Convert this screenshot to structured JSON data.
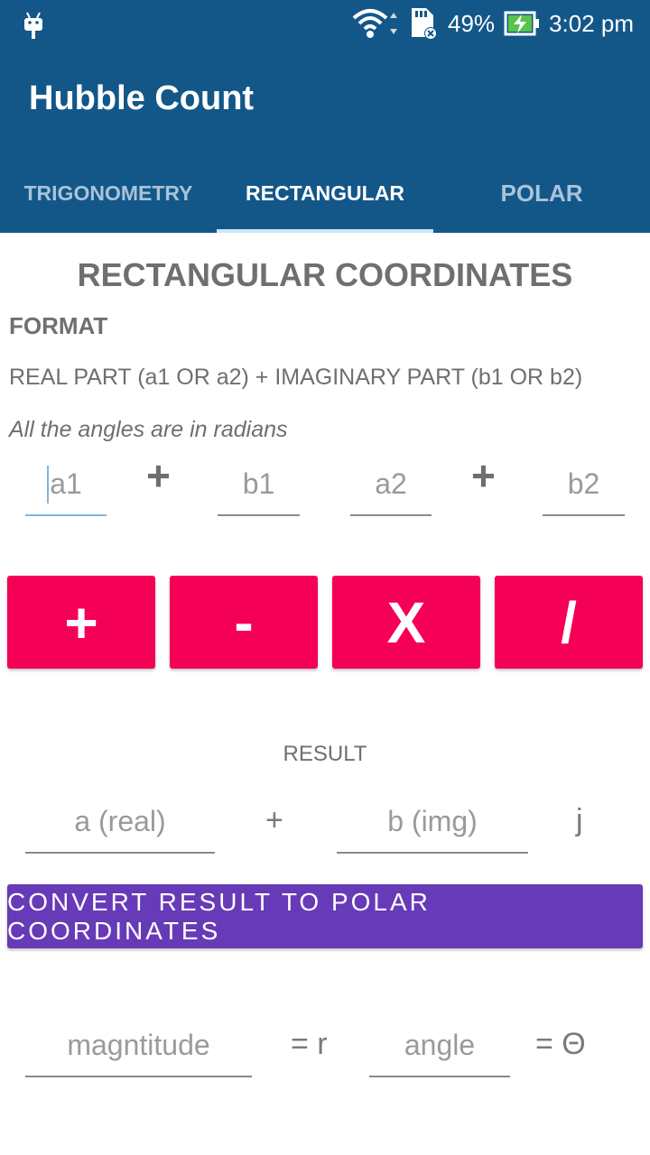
{
  "status_bar": {
    "battery": "49%",
    "time": "3:02 pm",
    "icons": [
      "android-icon",
      "wifi-icon",
      "sd-card-icon",
      "battery-charging-icon"
    ]
  },
  "app": {
    "title": "Hubble Count",
    "colors": {
      "primary": "#135789",
      "accent": "#f50057",
      "convert": "#673ab7"
    }
  },
  "tabs": [
    {
      "label": "TRIGONOMETRY",
      "active": false
    },
    {
      "label": "RECTANGULAR",
      "active": true
    },
    {
      "label": "POLAR",
      "active": false
    }
  ],
  "content": {
    "heading": "RECTANGULAR COORDINATES",
    "format_label": "FORMAT",
    "format_text": "REAL PART (a1 OR a2) + IMAGINARY PART (b1 OR b2)",
    "angles_note": "All the angles are in radians",
    "inputs": {
      "a1_placeholder": "a1",
      "b1_placeholder": "b1",
      "a2_placeholder": "a2",
      "b2_placeholder": "b2",
      "plus": "+"
    },
    "operations": {
      "add": "+",
      "subtract": "-",
      "multiply": "X",
      "divide": "/"
    },
    "result": {
      "label": "RESULT",
      "real_placeholder": "a (real)",
      "plus": "+",
      "img_placeholder": "b (img)",
      "j": "j"
    },
    "convert_button": "CONVERT RESULT TO POLAR COORDINATES",
    "polar": {
      "magnitude_placeholder": "magntitude",
      "r_label": "= r",
      "angle_placeholder": "angle",
      "theta_label": "= Θ"
    }
  }
}
